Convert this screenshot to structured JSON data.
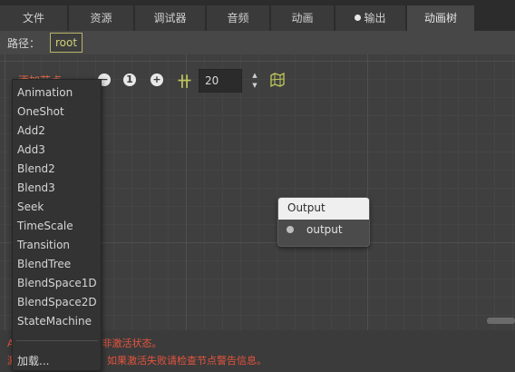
{
  "tabs": [
    {
      "label": "文件"
    },
    {
      "label": "资源"
    },
    {
      "label": "调试器"
    },
    {
      "label": "音频"
    },
    {
      "label": "动画"
    },
    {
      "label": "输出",
      "has_dot": true
    },
    {
      "label": "动画树",
      "active": true
    }
  ],
  "path": {
    "label": "路径：",
    "value": "root"
  },
  "toolbar": {
    "add_node_label": "添加节点",
    "zoom_out_icon": "minus-circle-icon",
    "zoom_reset_label": "1",
    "zoom_in_icon": "plus-circle-icon",
    "snap_icon": "snap-grid-icon",
    "snap_value": "20",
    "minimap_icon": "grid-map-icon"
  },
  "node": {
    "title": "Output",
    "port": "output"
  },
  "status": {
    "line1": "AnimationTree 处于非激活状态。",
    "line2": "激活以启用播放功能，如果激活失败请检查节点警告信息。"
  },
  "menu": {
    "items": [
      "Animation",
      "OneShot",
      "Add2",
      "Add3",
      "Blend2",
      "Blend3",
      "Seek",
      "TimeScale",
      "Transition",
      "BlendTree",
      "BlendSpace1D",
      "BlendSpace2D",
      "StateMachine"
    ],
    "load_label": "加载..."
  },
  "colors": {
    "accent_path": "#cfcf7a",
    "error_text": "#e5533d",
    "snap_icon": "#bfc85a"
  }
}
